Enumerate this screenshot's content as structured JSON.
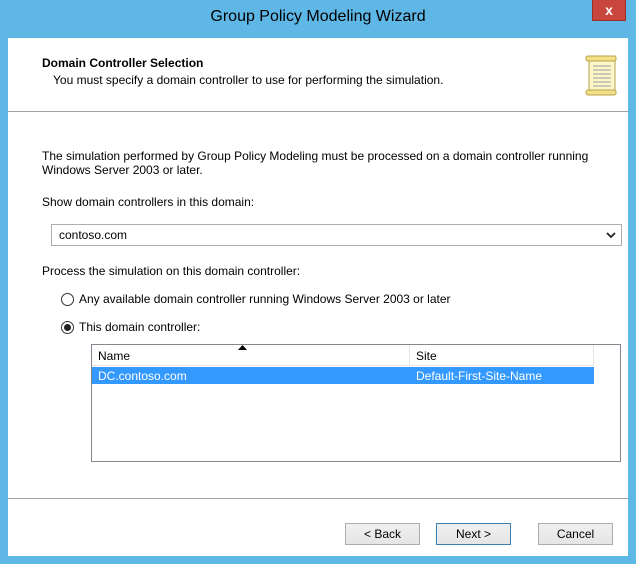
{
  "window": {
    "title": "Group Policy Modeling Wizard",
    "close_glyph": "x"
  },
  "header": {
    "title": "Domain Controller Selection",
    "subtitle": "You must specify a domain controller to use for performing the simulation.",
    "icon": "scroll-icon"
  },
  "content": {
    "intro_line1": "The simulation performed by Group Policy Modeling must be processed on a domain controller running",
    "intro_line2": "Windows Server 2003 or later.",
    "domain_label": "Show domain controllers in this domain:",
    "domain_value": "contoso.com",
    "process_label": "Process the simulation on this domain controller:",
    "radio_any_label": "Any available domain controller running Windows Server 2003 or later",
    "radio_this_label": "This domain controller:",
    "selected_option": "this"
  },
  "list": {
    "columns": [
      "Name",
      "Site"
    ],
    "rows": [
      {
        "name": "DC.contoso.com",
        "site": "Default-First-Site-Name",
        "selected": true
      }
    ]
  },
  "buttons": {
    "back": "< Back",
    "next": "Next >",
    "cancel": "Cancel"
  },
  "colors": {
    "frame": "#5fb7e6",
    "selection": "#3399ff",
    "close": "#c9463d"
  }
}
